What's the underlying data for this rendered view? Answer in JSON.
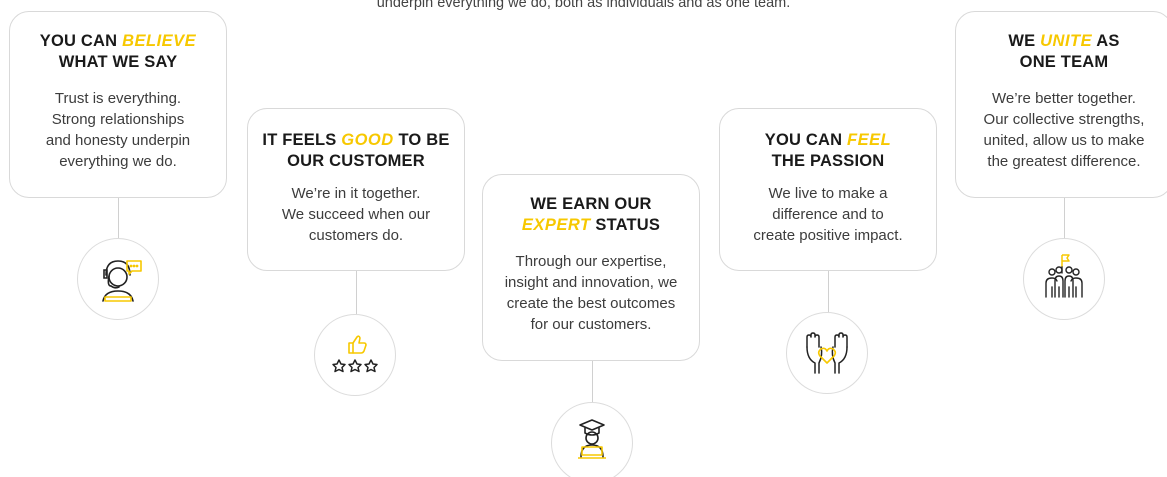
{
  "intro_text": "underpin everything we do, both as individuals and as one team.",
  "accent_color": "#f7c800",
  "values": [
    {
      "title_pre": "YOU CAN ",
      "title_accent": "BELIEVE",
      "title_post": "",
      "title_line2": "WHAT WE SAY",
      "body": [
        "Trust is everything.",
        "Strong relationships",
        "and honesty underpin",
        "everything we do."
      ],
      "icon": "customer-support-headset-icon"
    },
    {
      "title_pre": "IT FEELS ",
      "title_accent": "GOOD",
      "title_post": " TO BE",
      "title_line2": "OUR CUSTOMER",
      "body": [
        "We’re in it together.",
        "We succeed when our",
        "customers do."
      ],
      "icon": "thumbs-up-rating-icon"
    },
    {
      "title_pre": "WE EARN OUR",
      "title_accent": "",
      "title_post": "",
      "title_line2_accent": "EXPERT",
      "title_line2": " STATUS",
      "body": [
        "Through our expertise,",
        "insight and innovation, we",
        "create the best outcomes",
        "for our customers."
      ],
      "icon": "graduate-laptop-icon"
    },
    {
      "title_pre": "YOU CAN ",
      "title_accent": "FEEL",
      "title_post": "",
      "title_line2": "THE PASSION",
      "body": [
        "We live to make a",
        "difference and to",
        "create positive impact."
      ],
      "icon": "hands-heart-icon"
    },
    {
      "title_pre": "WE ",
      "title_accent": "UNITE",
      "title_post": " AS",
      "title_line2": "ONE TEAM",
      "body": [
        "We’re better together.",
        "Our collective strengths,",
        "united, allow us to make",
        "the greatest difference."
      ],
      "icon": "team-flag-icon"
    }
  ]
}
